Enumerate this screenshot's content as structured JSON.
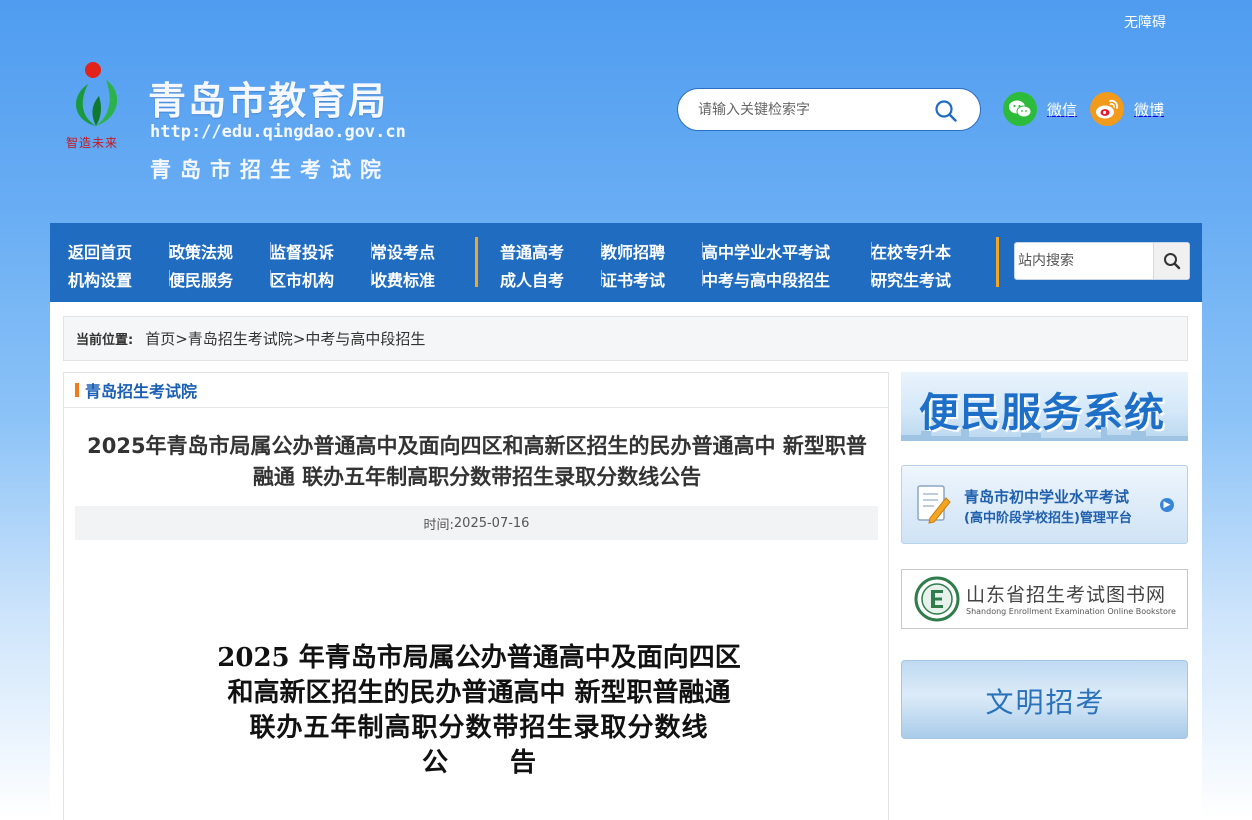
{
  "top": {
    "accessibility": "无障碍"
  },
  "header": {
    "motto": "智造未来",
    "title": "青岛市教育局",
    "url": "http://edu.qingdao.gov.cn",
    "subtitle": "青岛市招生考试院",
    "search_placeholder": "请输入关键检索字",
    "social": {
      "wechat": "微信",
      "weibo": "微博"
    }
  },
  "nav": {
    "group1": [
      [
        "返回首页",
        "政策法规",
        "监督投诉",
        "常设考点"
      ],
      [
        "机构设置",
        "便民服务",
        "区市机构",
        "收费标准"
      ]
    ],
    "group2": [
      [
        "普通高考",
        "教师招聘",
        "高中学业水平考试",
        "在校专升本"
      ],
      [
        "成人自考",
        "证书考试",
        "中考与高中段招生",
        "研究生考试"
      ]
    ],
    "search_placeholder": "站内搜索"
  },
  "breadcrumb": {
    "label": "当前位置:",
    "items": [
      "首页",
      "青岛招生考试院",
      "中考与高中段招生"
    ],
    "separator": ">"
  },
  "article": {
    "section": "青岛招生考试院",
    "title": "2025年青岛市局属公办普通高中及面向四区和高新区招生的民办普通高中 新型职普融通 联办五年制高职分数带招生录取分数线公告",
    "date_label": "时间:",
    "date": "2025-07-16",
    "doc_title_lines": [
      "2025 年青岛市局属公办普通高中及面向四区",
      "和高新区招生的民办普通高中 新型职普融通",
      "联办五年制高职分数带招生录取分数线"
    ],
    "doc_title_last": [
      "公",
      "告"
    ]
  },
  "sidebar": {
    "banner1": "便民服务系统",
    "banner2": {
      "line1": "青岛市初中学业水平考试",
      "line2": "(高中阶段学校招生)管理平台"
    },
    "banner3": {
      "line1": "山东省招生考试图书网",
      "line2": "Shandong Enrollment Examination Online Bookstore"
    },
    "banner4": "文明招考"
  },
  "colors": {
    "nav_bg": "#1f6cc0",
    "accent_orange": "#f07b1d",
    "link_blue": "#1a5fb4"
  }
}
